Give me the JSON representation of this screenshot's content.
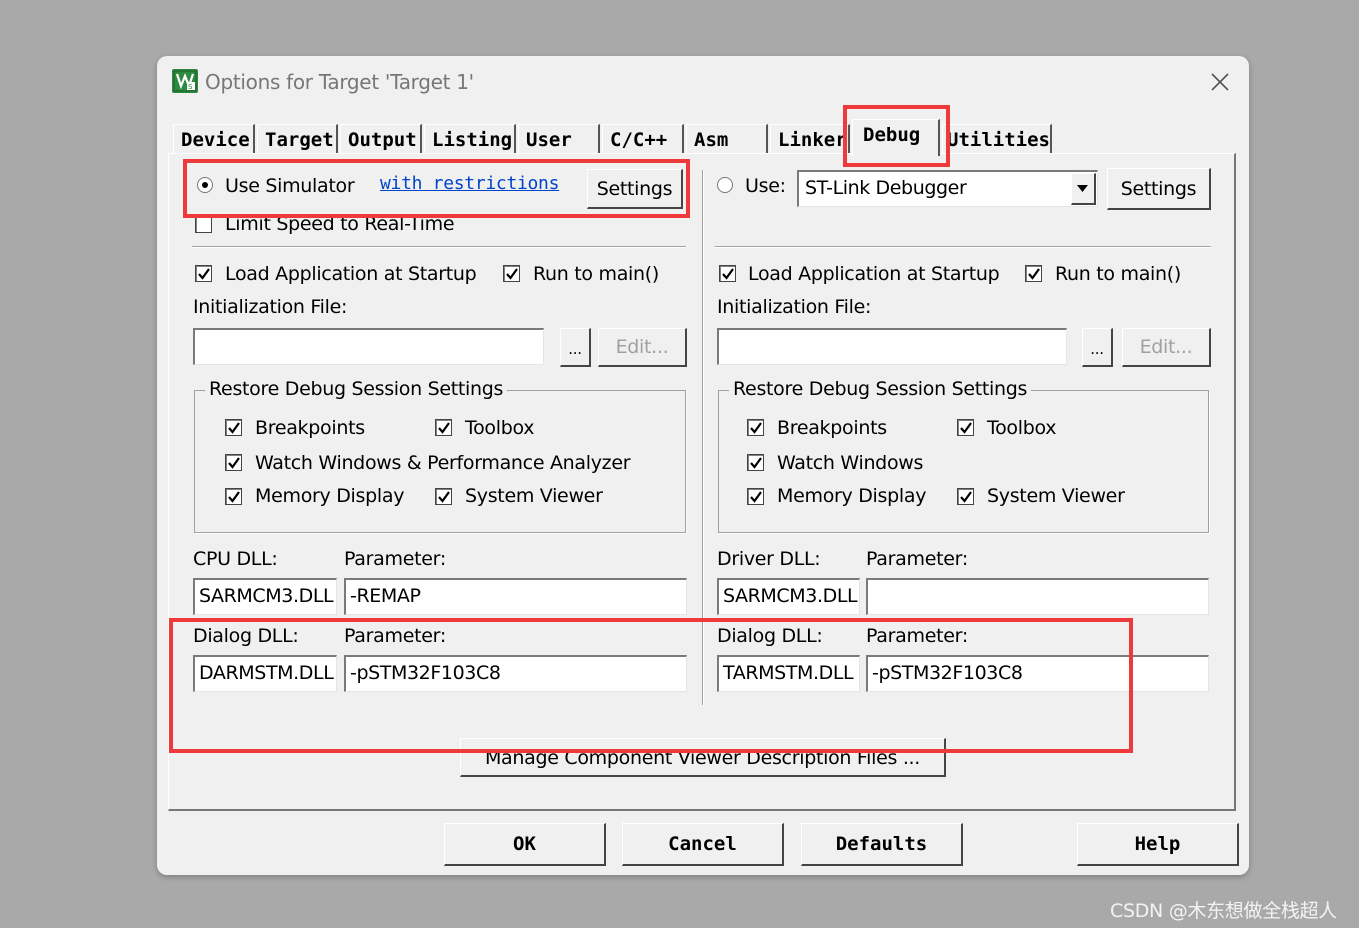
{
  "window": {
    "title": "Options for Target 'Target 1'"
  },
  "tabs": [
    "Device",
    "Target",
    "Output",
    "Listing",
    "User",
    "C/C++",
    "Asm",
    "Linker",
    "Debug",
    "Utilities"
  ],
  "simulator": {
    "use_simulator_label": "Use Simulator",
    "restrictions_link": "with restrictions",
    "settings_label": "Settings",
    "limit_speed_label": "Limit Speed to Real-Time",
    "load_app_label": "Load Application at Startup",
    "run_to_main_label": "Run to main()",
    "init_file_label": "Initialization File:",
    "init_file_value": "",
    "browse_label": "...",
    "edit_label": "Edit...",
    "restore_group_label": "Restore Debug Session Settings",
    "breakpoints_label": "Breakpoints",
    "toolbox_label": "Toolbox",
    "watch_label": "Watch Windows & Performance Analyzer",
    "memory_label": "Memory Display",
    "system_viewer_label": "System Viewer",
    "cpu_dll_label": "CPU DLL:",
    "cpu_param_label": "Parameter:",
    "cpu_dll_value": "SARMCM3.DLL",
    "cpu_param_value": "-REMAP",
    "dialog_dll_label": "Dialog DLL:",
    "dialog_param_label": "Parameter:",
    "dialog_dll_value": "DARMSTM.DLL",
    "dialog_param_value": "-pSTM32F103C8"
  },
  "target": {
    "use_label": "Use:",
    "debugger_selected": "ST-Link Debugger",
    "settings_label": "Settings",
    "load_app_label": "Load Application at Startup",
    "run_to_main_label": "Run to main()",
    "init_file_label": "Initialization File:",
    "init_file_value": "",
    "browse_label": "...",
    "edit_label": "Edit...",
    "restore_group_label": "Restore Debug Session Settings",
    "breakpoints_label": "Breakpoints",
    "toolbox_label": "Toolbox",
    "watch_label": "Watch Windows",
    "memory_label": "Memory Display",
    "system_viewer_label": "System Viewer",
    "driver_dll_label": "Driver DLL:",
    "driver_param_label": "Parameter:",
    "driver_dll_value": "SARMCM3.DLL",
    "driver_param_value": "",
    "dialog_dll_label": "Dialog DLL:",
    "dialog_param_label": "Parameter:",
    "dialog_dll_value": "TARMSTM.DLL",
    "dialog_param_value": "-pSTM32F103C8"
  },
  "manage_button": "Manage Component Viewer Description Files ...",
  "footer": {
    "ok": "OK",
    "cancel": "Cancel",
    "defaults": "Defaults",
    "help": "Help"
  },
  "watermark": "CSDN @木东想做全栈超人",
  "colors": {
    "annotation_red": "#ee3a3a",
    "link_blue": "#0044cc",
    "app_icon_green": "#2d8a3e"
  }
}
